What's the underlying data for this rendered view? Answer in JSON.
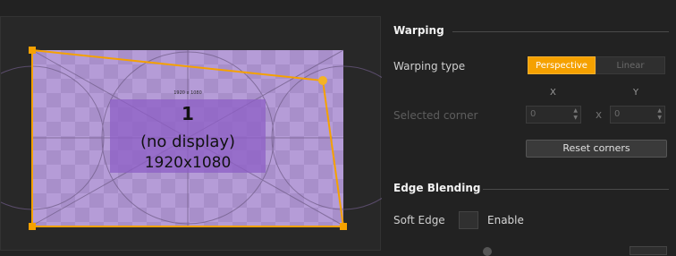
{
  "preview": {
    "resolution_small": "1920 x 1080",
    "display_number": "1",
    "display_status": "(no display)",
    "resolution": "1920x1080"
  },
  "warping": {
    "title": "Warping",
    "type_label": "Warping type",
    "type_options": [
      "Perspective",
      "Linear"
    ],
    "type_selected": "Perspective",
    "axis_x": "X",
    "axis_y": "Y",
    "selected_corner_label": "Selected corner",
    "corner_x": "0",
    "corner_y": "0",
    "separator": "x",
    "reset_button": "Reset corners"
  },
  "edge_blending": {
    "title": "Edge Blending",
    "soft_edge_label": "Soft Edge",
    "enable_label": "Enable"
  },
  "colors": {
    "accent": "#f5a100",
    "test_pattern": "#b49bd6",
    "center_box": "#8e5fc6",
    "panel_bg": "#222222"
  }
}
